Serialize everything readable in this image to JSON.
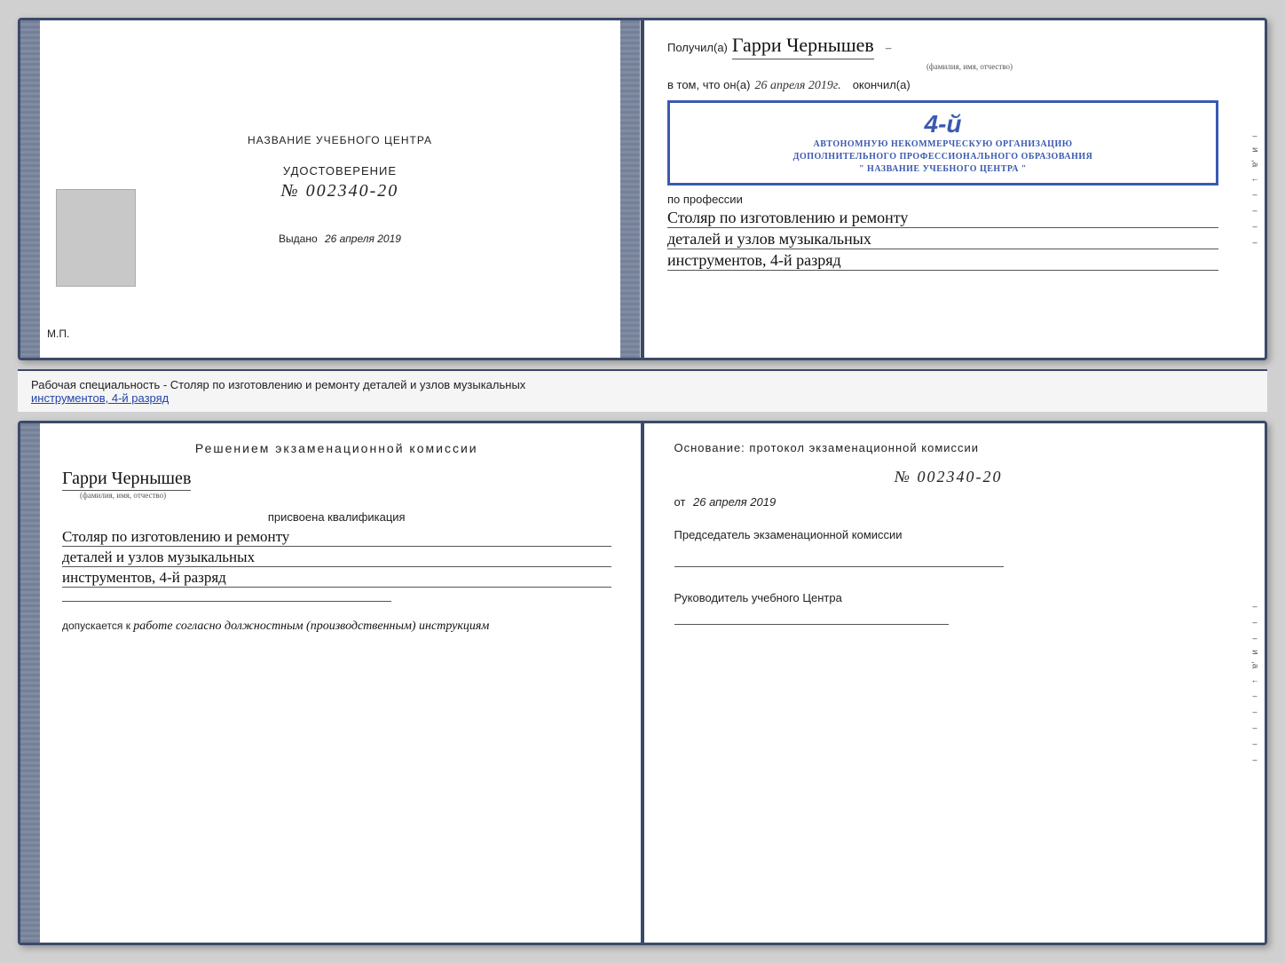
{
  "top_left": {
    "center_title": "НАЗВАНИЕ УЧЕБНОГО ЦЕНТРА",
    "udostoverenie_label": "УДОСТОВЕРЕНИЕ",
    "number": "№ 002340-20",
    "vydano_label": "Выдано",
    "vydano_date": "26 апреля 2019",
    "mp_label": "М.П."
  },
  "top_right": {
    "poluchil_label": "Получил(а)",
    "recipient_name": "Гарри Чернышев",
    "fio_hint": "(фамилия, имя, отчество)",
    "vtom_label": "в том, что он(а)",
    "date_handwritten": "26 апреля 2019г.",
    "okonchil_label": "окончил(а)",
    "stamp_number": "4-й",
    "stamp_line1": "АВТОНОМНУЮ НЕКОММЕРЧЕСКУЮ ОРГАНИЗАЦИЮ",
    "stamp_line2": "ДОПОЛНИТЕЛЬНОГО ПРОФЕССИОНАЛЬНОГО ОБРАЗОВАНИЯ",
    "stamp_line3": "\" НАЗВАНИЕ УЧЕБНОГО ЦЕНТРА \"",
    "po_professii_label": "по профессии",
    "profession_line1": "Столяр по изготовлению и ремонту",
    "profession_line2": "деталей и узлов музыкальных",
    "profession_line3": "инструментов, 4-й разряд"
  },
  "description": {
    "text": "Рабочая специальность - Столяр по изготовлению и ремонту деталей и узлов музыкальных",
    "text2": "инструментов, 4-й разряд"
  },
  "bottom_left": {
    "reshen_title": "Решением  экзаменационной  комиссии",
    "recipient_name": "Гарри Чернышев",
    "fio_hint": "(фамилия, имя, отчество)",
    "prisvoena_label": "присвоена квалификация",
    "qual_line1": "Столяр по изготовлению и ремонту",
    "qual_line2": "деталей и узлов музыкальных",
    "qual_line3": "инструментов, 4-й разряд",
    "dopuskaetsya_label": "допускается к",
    "dopuskaetsya_text": "работе согласно должностным (производственным) инструкциям"
  },
  "bottom_right": {
    "osnovanie_label": "Основание: протокол экзаменационной  комиссии",
    "protocol_num": "№  002340-20",
    "ot_label": "от",
    "ot_date": "26 апреля 2019",
    "predsedatel_label": "Председатель экзаменационной комиссии",
    "rukovoditel_label": "Руководитель учебного Центра"
  },
  "side_marks": {
    "и": "и",
    "а": "а",
    "arrow": "←",
    "dashes": [
      "–",
      "–",
      "–",
      "–",
      "–",
      "–"
    ]
  }
}
